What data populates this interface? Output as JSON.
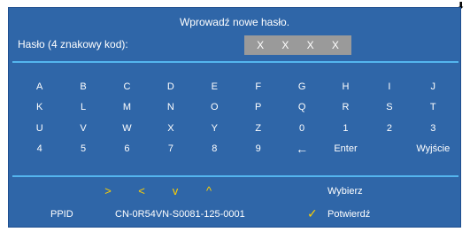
{
  "header": {
    "title": "Wprowadź nowe hasło."
  },
  "password": {
    "label": "Hasło (4 znakowy kod):",
    "chars": [
      "X",
      "X",
      "X",
      "X"
    ]
  },
  "keyboard": {
    "rows": [
      [
        "A",
        "B",
        "C",
        "D",
        "E",
        "F",
        "G",
        "H",
        "I",
        "J"
      ],
      [
        "K",
        "L",
        "M",
        "N",
        "O",
        "P",
        "Q",
        "R",
        "S",
        "T"
      ],
      [
        "U",
        "V",
        "W",
        "X",
        "Y",
        "Z",
        "0",
        "1",
        "2",
        "3"
      ],
      [
        "4",
        "5",
        "6",
        "7",
        "8",
        "9",
        "←",
        "Enter",
        "",
        "Wyjście"
      ]
    ]
  },
  "footer": {
    "nav_icons": [
      "chevron-right-icon",
      "chevron-left-icon",
      "chevron-down-icon",
      "chevron-up-icon"
    ],
    "nav_glyphs": [
      ">",
      "<",
      "v",
      "^"
    ],
    "select_label": "Wybierz",
    "ppid_label": "PPID",
    "ppid_value": "CN-0R54VN-S0081-125-0001",
    "confirm_label": "Potwierdź"
  },
  "colors": {
    "panel": "#2f66a8",
    "divider": "#54b5ee",
    "accent": "#ffd000",
    "code_box": "#9a9a9a"
  }
}
